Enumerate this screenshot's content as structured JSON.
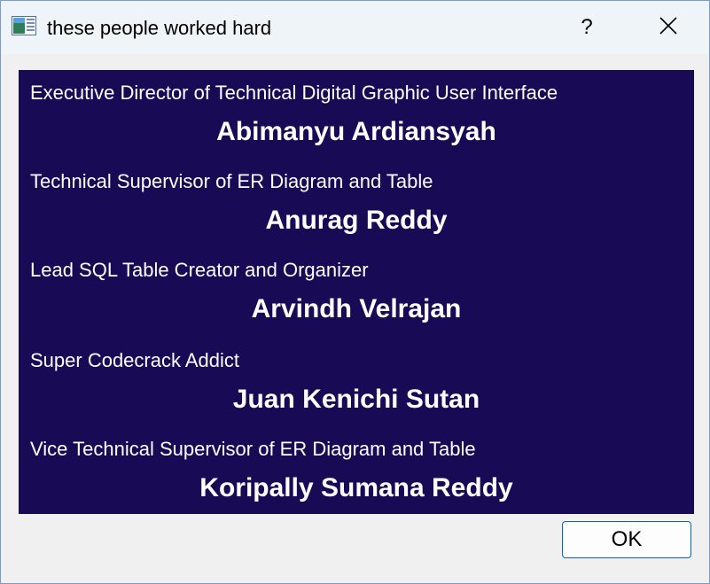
{
  "window": {
    "title": "these people worked hard",
    "help_label": "?",
    "app_icon": "window-app-icon",
    "close_icon": "close-icon"
  },
  "credits": [
    {
      "role": "Executive Director of Technical Digital Graphic User Interface",
      "name": "Abimanyu Ardiansyah"
    },
    {
      "role": "Technical Supervisor of ER Diagram and Table",
      "name": "Anurag Reddy"
    },
    {
      "role": "Lead SQL Table Creator and Organizer",
      "name": "Arvindh Velrajan"
    },
    {
      "role": "Super Codecrack Addict",
      "name": "Juan Kenichi Sutan"
    },
    {
      "role": "Vice Technical Supervisor of ER Diagram and Table",
      "name": "Koripally Sumana Reddy"
    }
  ],
  "buttons": {
    "ok_label": "OK"
  },
  "colors": {
    "panel_background": "#180a55",
    "text": "#ffffff",
    "ok_border": "#0067c0"
  }
}
